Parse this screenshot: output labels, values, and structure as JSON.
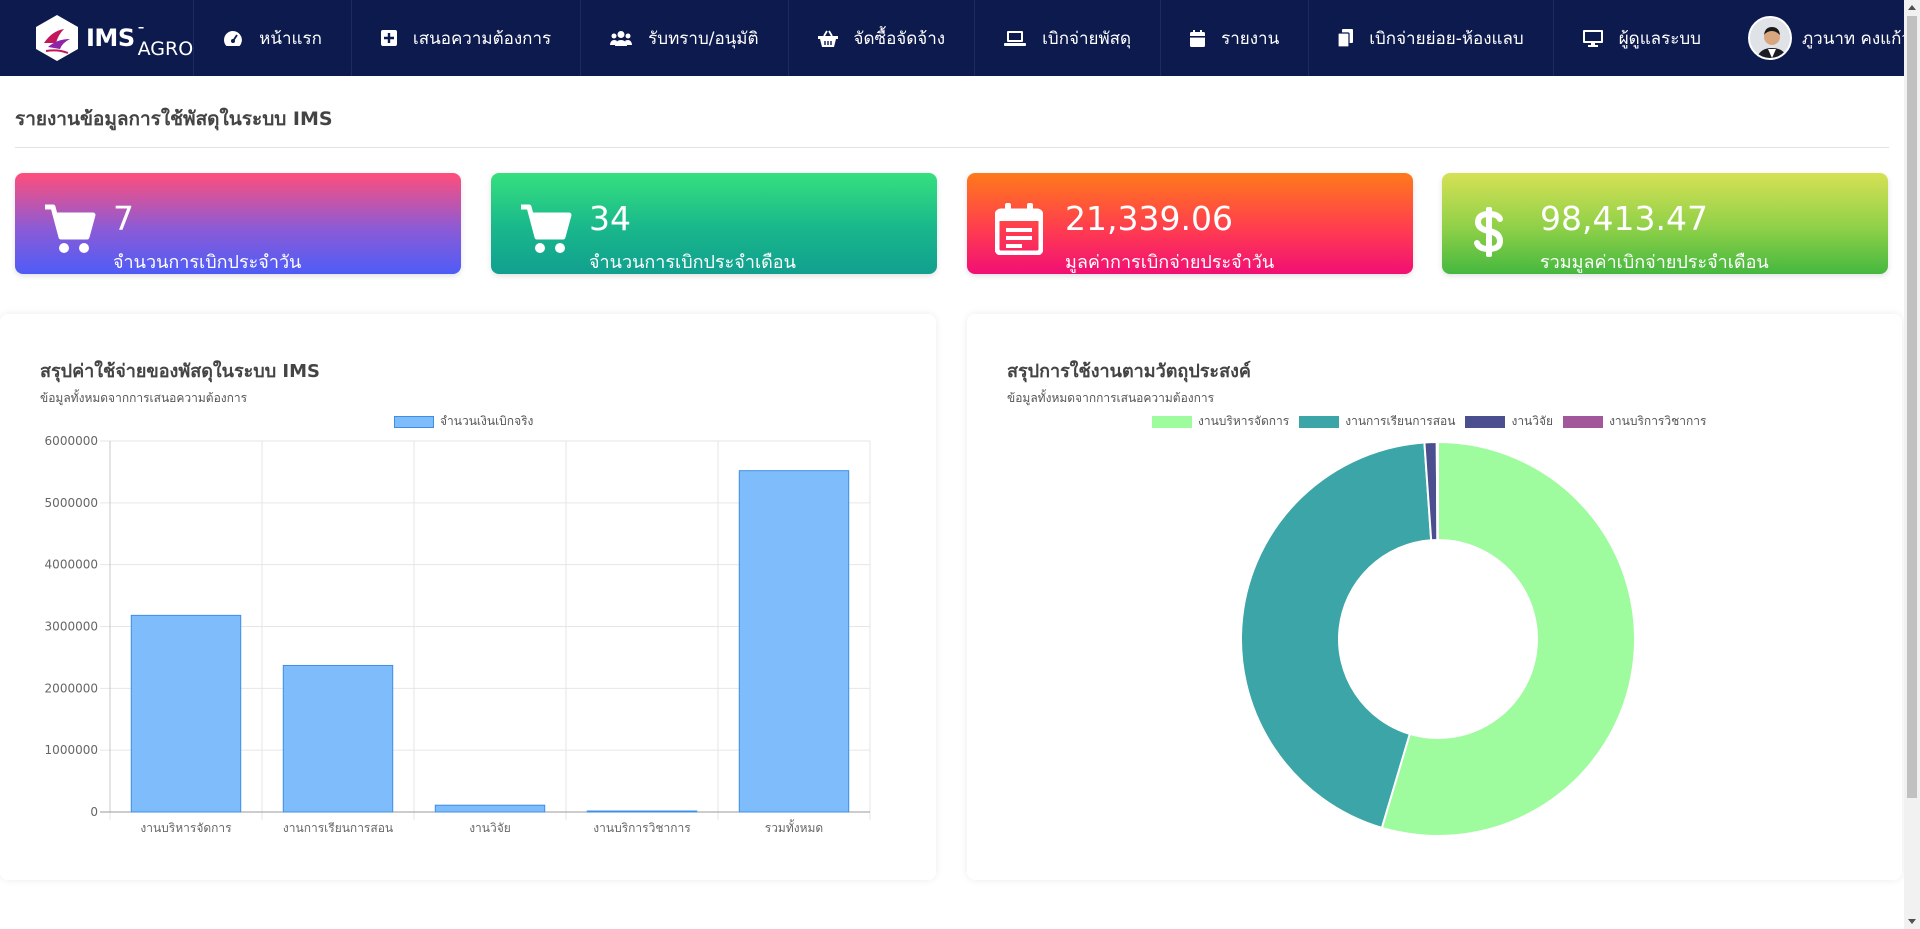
{
  "navbar": {
    "brand": "IMS",
    "brand_sub": "- AGRO",
    "items": [
      {
        "label": "หน้าแรก",
        "icon": "dashboard-icon"
      },
      {
        "label": "เสนอความต้องการ",
        "icon": "plus-square-icon"
      },
      {
        "label": "รับทราบ/อนุมัติ",
        "icon": "users-icon"
      },
      {
        "label": "จัดซื้อจัดจ้าง",
        "icon": "basket-icon"
      },
      {
        "label": "เบิกจ่ายพัสดุ",
        "icon": "laptop-icon"
      },
      {
        "label": "รายงาน",
        "icon": "calendar-icon"
      },
      {
        "label": "เบิกจ่ายย่อย-ห้องแลบ",
        "icon": "copy-icon"
      },
      {
        "label": "ผู้ดูแลระบบ",
        "icon": "desktop-icon"
      }
    ],
    "user_name": "ภูวนาท คงแก้ว"
  },
  "page": {
    "title": "รายงานข้อมูลการใช้พัสดุในระบบ IMS"
  },
  "stats": [
    {
      "value": "7",
      "label": "จำนวนการเบิกประจำวัน",
      "icon": "cart-icon"
    },
    {
      "value": "34",
      "label": "จำนวนการเบิกประจำเดือน",
      "icon": "cart-icon"
    },
    {
      "value": "21,339.06",
      "label": "มูลค่าการเบิกจ่ายประจำวัน",
      "icon": "calendar-note-icon"
    },
    {
      "value": "98,413.47",
      "label": "รวมมูลค่าเบิกจ่ายประจำเดือน",
      "icon": "dollar-icon"
    }
  ],
  "colors": {
    "bar_fill": "#7fbcfb",
    "bar_stroke": "#3d8fe5",
    "donut": [
      "#9efb9e",
      "#3ba5a7",
      "#4c4f8f",
      "#a3579b"
    ]
  },
  "chart_data": [
    {
      "type": "bar",
      "title": "สรุปค่าใช้จ่ายของพัสดุในระบบ IMS",
      "subtitle": "ข้อมูลทั้งหมดจากการเสนอความต้องการ",
      "categories": [
        "งานบริหารจัดการ",
        "งานการเรียนการสอน",
        "งานวิจัย",
        "งานบริการวิชาการ",
        "รวมทั้งหมด"
      ],
      "series": [
        {
          "name": "จำนวนเงินเบิกจริง",
          "values": [
            3180000,
            2370000,
            110000,
            10000,
            5520000
          ]
        }
      ],
      "ylim": [
        0,
        6000000
      ],
      "yticks": [
        "0",
        "1000000",
        "2000000",
        "3000000",
        "4000000",
        "5000000",
        "6000000"
      ],
      "grid": true,
      "legend": "top"
    },
    {
      "type": "pie",
      "title": "สรุปการใช้งานตามวัตถุประสงค์",
      "subtitle": "ข้อมูลทั้งหมดจากการเสนอความต้องการ",
      "categories": [
        "งานบริหารจัดการ",
        "งานการเรียนการสอน",
        "งานวิจัย",
        "งานบริการวิชาการ"
      ],
      "values": [
        54.6,
        44.3,
        1.0,
        0.1
      ],
      "legend": "top"
    }
  ]
}
